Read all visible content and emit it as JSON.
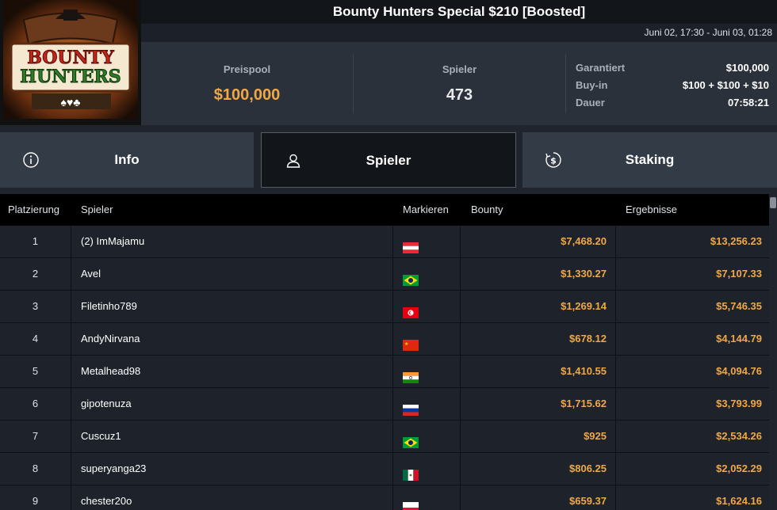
{
  "logo": {
    "line1": "BOUNTY",
    "line2": "HUNTERS"
  },
  "tournament": {
    "title": "Bounty Hunters Special $210 [Boosted]",
    "dates": "Juni 02, 17:30 - Juni 03, 01:28"
  },
  "stats": {
    "prizepool_label": "Preispool",
    "prizepool_value": "$100,000",
    "players_label": "Spieler",
    "players_value": "473",
    "info": [
      {
        "label": "Garantiert",
        "value": "$100,000"
      },
      {
        "label": "Buy-in",
        "value": "$100 + $100 + $10"
      },
      {
        "label": "Dauer",
        "value": "07:58:21"
      }
    ]
  },
  "tabs": [
    {
      "label": "Info",
      "icon": "info-icon"
    },
    {
      "label": "Spieler",
      "icon": "user-icon",
      "active": true
    },
    {
      "label": "Staking",
      "icon": "dollar-cycle-icon"
    }
  ],
  "table": {
    "headers": {
      "rank": "Platzierung",
      "player": "Spieler",
      "flag": "Markieren",
      "bounty": "Bounty",
      "result": "Ergebnisse"
    },
    "rows": [
      {
        "rank": "1",
        "player": "(2) ImMajamu",
        "flag": "austria",
        "bounty": "$7,468.20",
        "result": "$13,256.23"
      },
      {
        "rank": "2",
        "player": "Avel",
        "flag": "brazil",
        "bounty": "$1,330.27",
        "result": "$7,107.33"
      },
      {
        "rank": "3",
        "player": "Filetinho789",
        "flag": "tunisia",
        "bounty": "$1,269.14",
        "result": "$5,746.35"
      },
      {
        "rank": "4",
        "player": "AndyNirvana",
        "flag": "china",
        "bounty": "$678.12",
        "result": "$4,144.79"
      },
      {
        "rank": "5",
        "player": "Metalhead98",
        "flag": "india",
        "bounty": "$1,410.55",
        "result": "$4,094.76"
      },
      {
        "rank": "6",
        "player": "gipotenuza",
        "flag": "russia",
        "bounty": "$1,715.62",
        "result": "$3,793.99"
      },
      {
        "rank": "7",
        "player": "Cuscuz1",
        "flag": "brazil",
        "bounty": "$925",
        "result": "$2,534.26"
      },
      {
        "rank": "8",
        "player": "superyanga23",
        "flag": "mexico",
        "bounty": "$806.25",
        "result": "$2,052.29"
      },
      {
        "rank": "9",
        "player": "chester20o",
        "flag": "poland",
        "bounty": "$659.37",
        "result": "$1,624.16"
      }
    ]
  },
  "colors": {
    "accent": "#f0a846",
    "background": "#20252d",
    "header": "#12151a"
  }
}
